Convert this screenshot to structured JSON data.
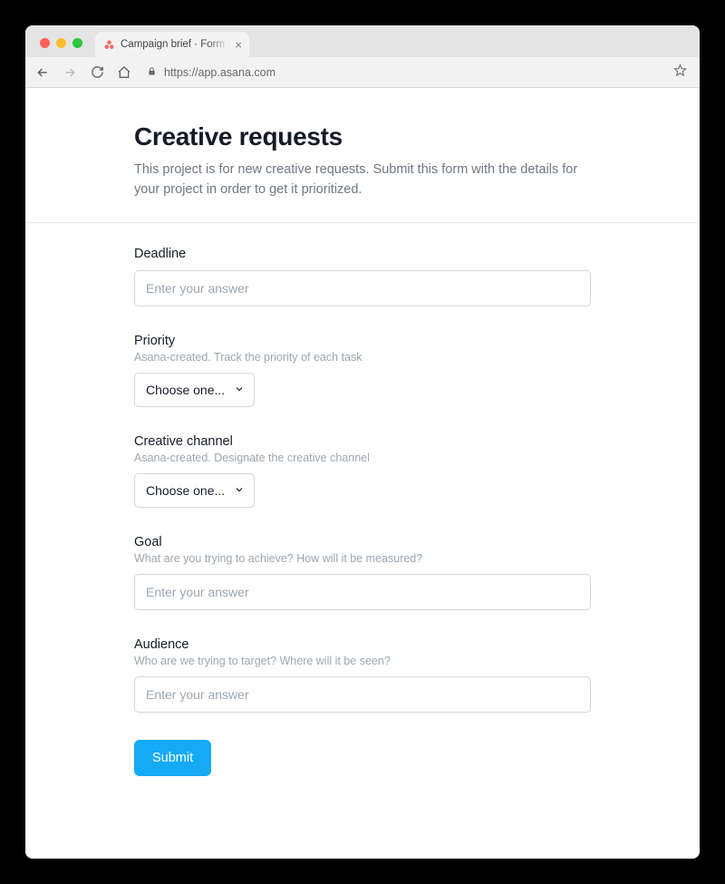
{
  "browser": {
    "tab_title": "Campaign brief · Form by Asana",
    "url": "https://app.asana.com"
  },
  "form": {
    "title": "Creative requests",
    "description": "This project is for new creative requests. Submit this form with the details for your project in order to get it prioritized.",
    "fields": {
      "deadline": {
        "label": "Deadline",
        "placeholder": "Enter your answer",
        "value": ""
      },
      "priority": {
        "label": "Priority",
        "help": "Asana-created. Track the priority of each task",
        "selected": "Choose one..."
      },
      "channel": {
        "label": "Creative channel",
        "help": "Asana-created. Designate the creative channel",
        "selected": "Choose one..."
      },
      "goal": {
        "label": "Goal",
        "help": "What are you trying to achieve? How will it be measured?",
        "placeholder": "Enter your answer",
        "value": ""
      },
      "audience": {
        "label": "Audience",
        "help": "Who are we trying to target? Where will it be seen?",
        "placeholder": "Enter your answer",
        "value": ""
      }
    },
    "submit_label": "Submit"
  }
}
